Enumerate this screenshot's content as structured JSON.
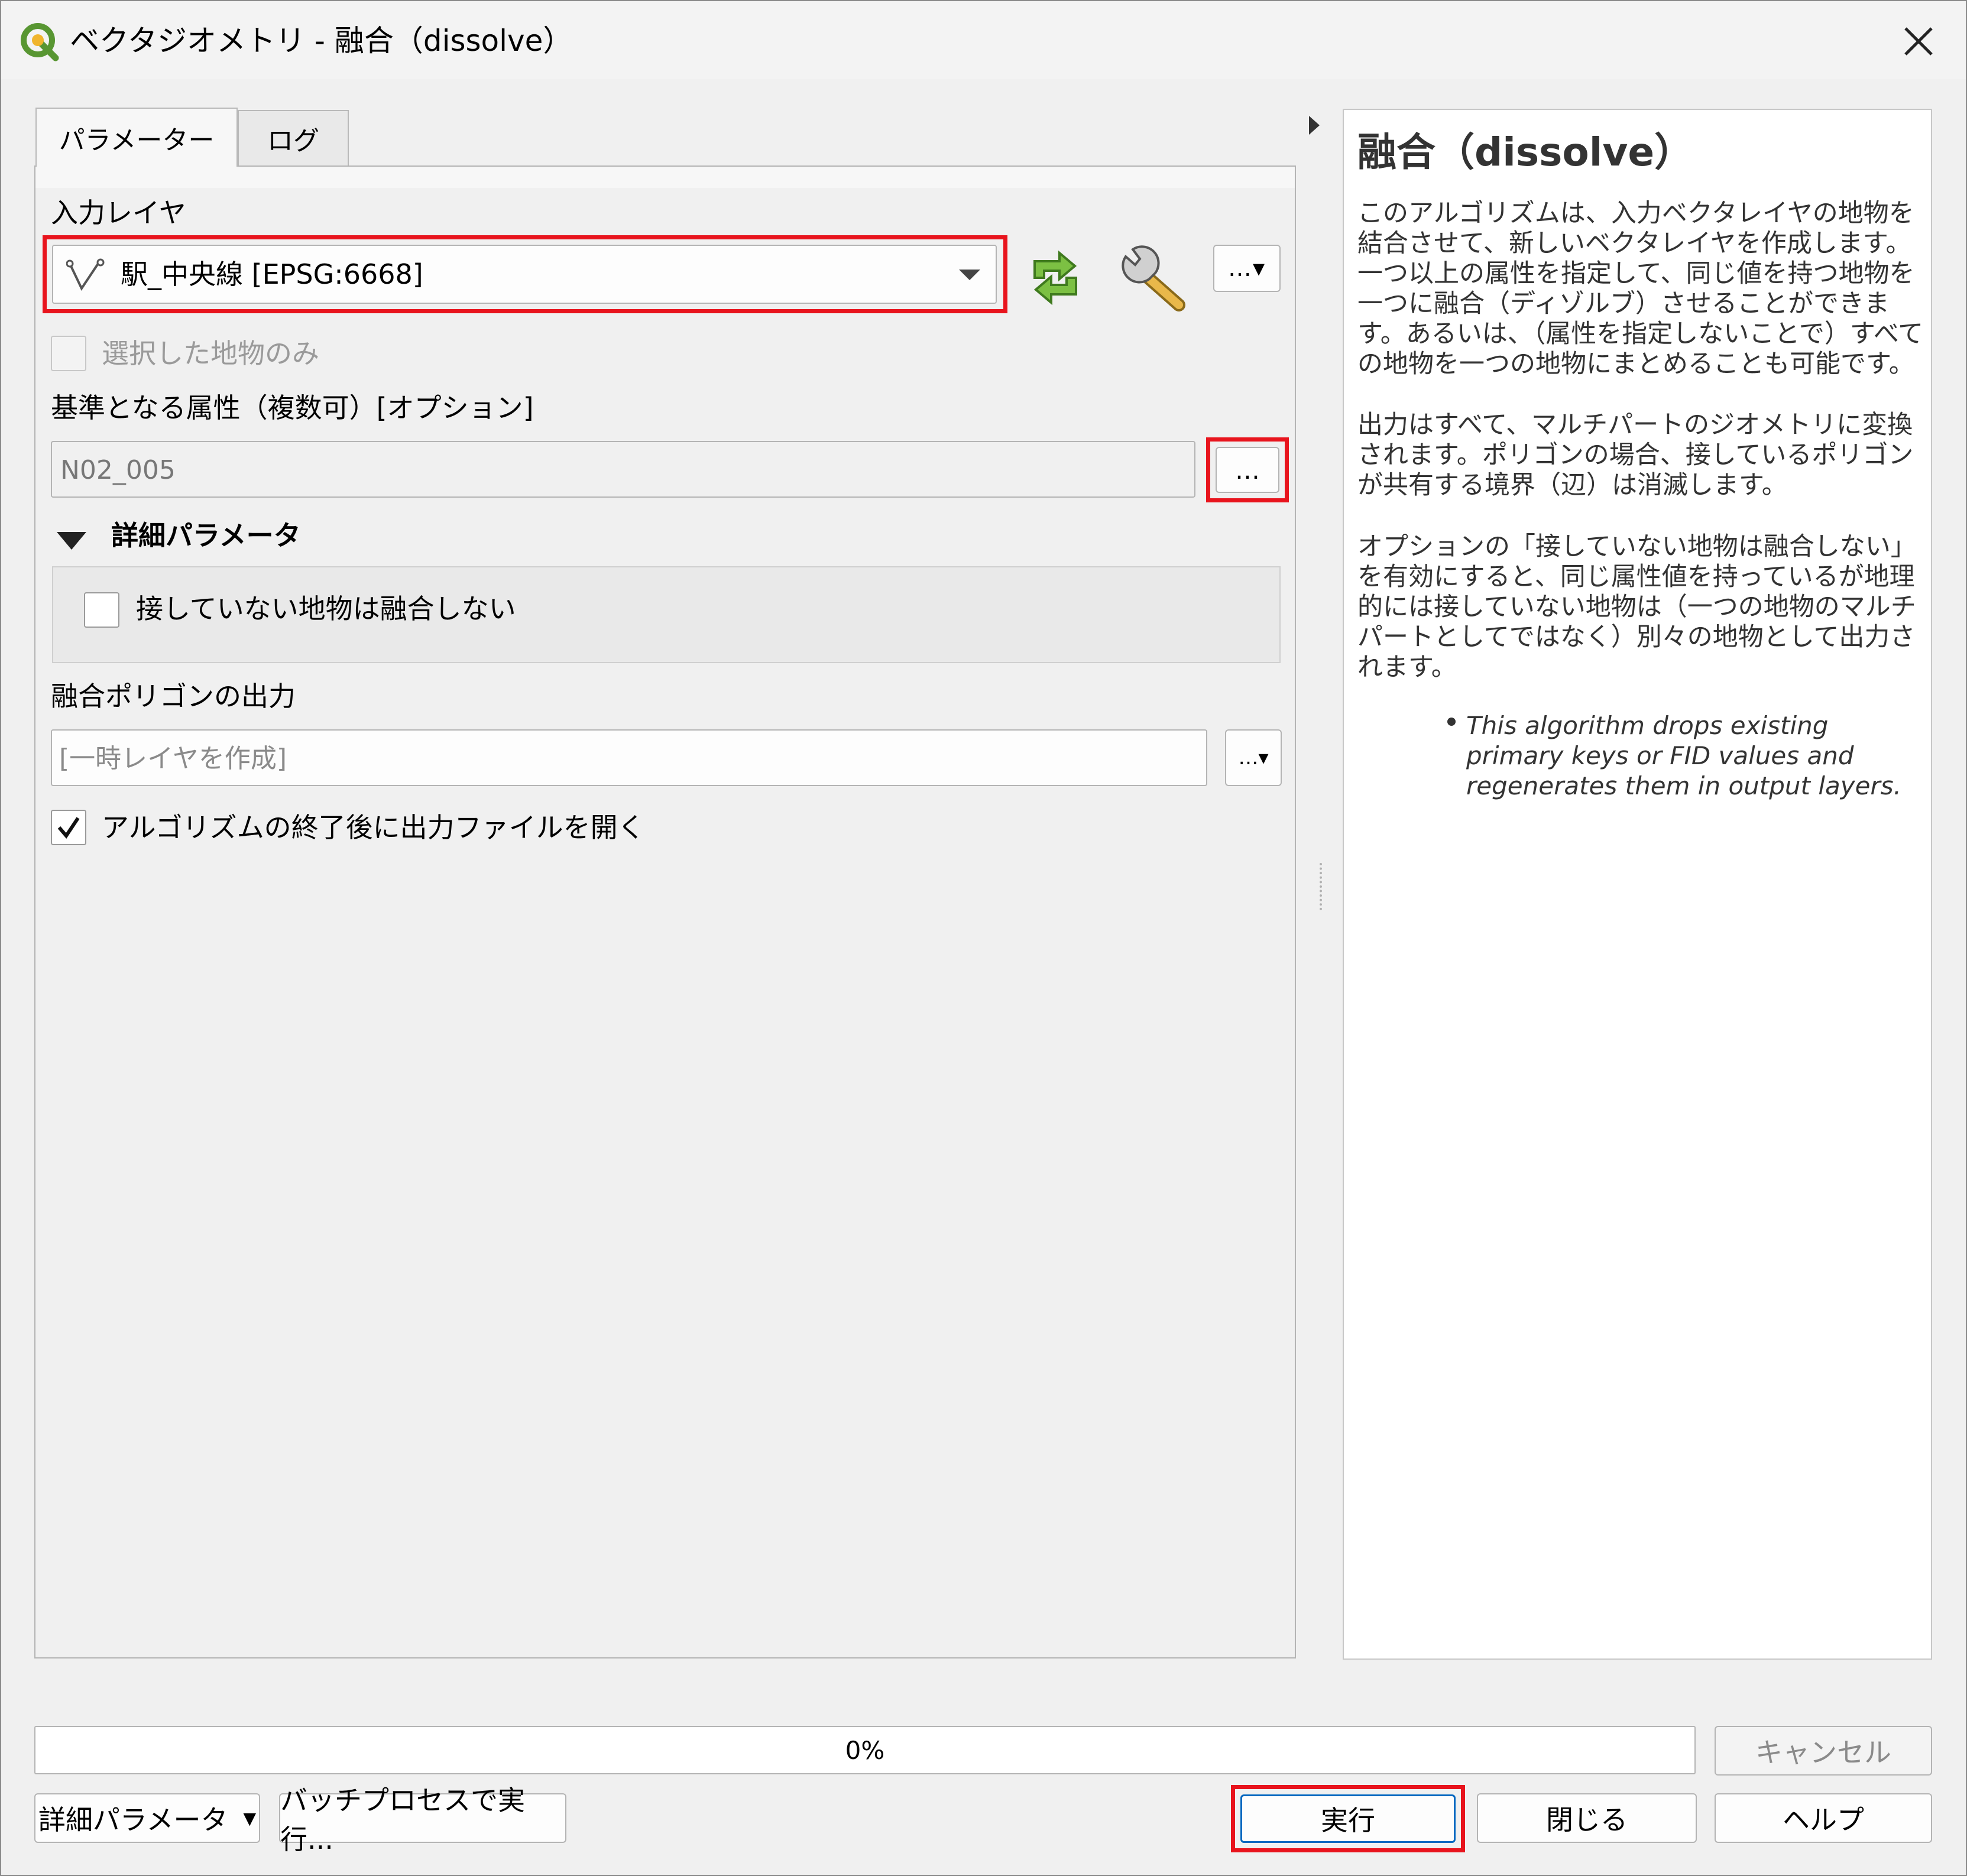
{
  "window": {
    "title": "ベクタジオメトリ - 融合（dissolve）"
  },
  "tabs": [
    {
      "label": "パラメーター",
      "active": true
    },
    {
      "label": "ログ",
      "active": false
    }
  ],
  "params": {
    "input_layer_label": "入力レイヤ",
    "input_layer_value": "駅_中央線 [EPSG:6668]",
    "selected_only_label": "選択した地物のみ",
    "selected_only_checked": false,
    "fields_label": "基準となる属性（複数可）[オプション]",
    "fields_value": "N02_005",
    "ellipsis": "…",
    "advanced_section_label": "詳細パラメータ",
    "keep_disjoint_label": "接していない地物は融合しない",
    "keep_disjoint_checked": false,
    "output_label": "融合ポリゴンの出力",
    "output_placeholder": "[一時レイヤを作成]",
    "open_output_label": "アルゴリズムの終了後に出力ファイルを開く",
    "open_output_checked": true
  },
  "help": {
    "title": "融合（dissolve）",
    "paragraph1": "このアルゴリズムは、入力ベクタレイヤの地物を結合させて、新しいベクタレイヤを作成します。一つ以上の属性を指定して、同じ値を持つ地物を一つに融合（ディゾルブ）させることができます。あるいは、（属性を指定しないことで）すべての地物を一つの地物にまとめることも可能です。",
    "paragraph2": "出力はすべて、マルチパートのジオメトリに変換されます。ポリゴンの場合、接しているポリゴンが共有する境界（辺）は消滅します。",
    "paragraph3": "オプションの「接していない地物は融合しない」を有効にすると、同じ属性値を持っているが地理的には接していない地物は（一つの地物のマルチパートとしてではなく）別々の地物として出力されます。",
    "note": "This algorithm drops existing primary keys or FID values and regenerates them in output layers."
  },
  "footer": {
    "progress_percent": 0,
    "progress_label": "0%",
    "cancel_label": "キャンセル",
    "advanced_label": "詳細パラメータ",
    "batch_label": "バッチプロセスで実行...",
    "run_label": "実行",
    "close_label": "閉じる",
    "help_label": "ヘルプ"
  },
  "colors": {
    "highlight": "#e8141d",
    "qgis_green": "#589632",
    "qgis_yellow": "#f0b52d"
  }
}
